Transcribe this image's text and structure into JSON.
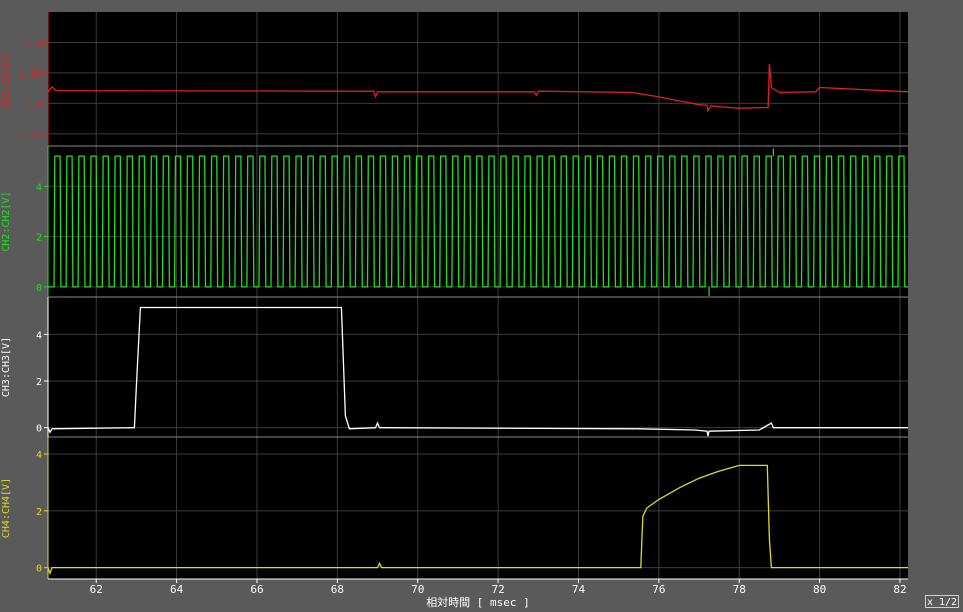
{
  "zoom_label": "x 1/2",
  "chart_data": {
    "type": "line",
    "x_label": "相対時間 [ msec ]",
    "x_range": [
      60.8,
      82.2
    ],
    "x_ticks": [
      62,
      64,
      66,
      68,
      70,
      72,
      74,
      76,
      78,
      80,
      82
    ],
    "grid": true,
    "background": "#000000",
    "channels": [
      {
        "name": "CH1:CH1[V]",
        "color": "#e02020",
        "y_range": [
          1.23,
          1.45
        ],
        "y_ticks": [
          1.4,
          1.35,
          1.3,
          1.25
        ],
        "tick_labels": [
          "1.4",
          "1.35",
          "1.3",
          "1.25"
        ],
        "x": [
          60.8,
          60.9,
          61.0,
          68.9,
          68.95,
          69.0,
          72.9,
          72.95,
          73.0,
          75.3,
          75.9,
          76.5,
          77.0,
          77.2,
          77.22,
          77.3,
          77.6,
          78.0,
          78.5,
          78.72,
          78.75,
          78.8,
          79.0,
          79.9,
          80.0,
          82.2
        ],
        "values": [
          1.318,
          1.327,
          1.321,
          1.32,
          1.311,
          1.319,
          1.319,
          1.313,
          1.32,
          1.318,
          1.312,
          1.304,
          1.298,
          1.297,
          1.288,
          1.296,
          1.294,
          1.292,
          1.293,
          1.293,
          1.365,
          1.326,
          1.318,
          1.319,
          1.326,
          1.319
        ]
      },
      {
        "name": "CH2:CH2[V]",
        "color": "#22dd22",
        "y_range": [
          -0.4,
          5.6
        ],
        "y_ticks": [
          0,
          2,
          4
        ],
        "tick_labels": [
          "0",
          "2",
          "4"
        ],
        "wave": "square",
        "low": 0.0,
        "high": 5.2,
        "period_ms": 0.3,
        "start_ms": 60.95,
        "notes": [
          {
            "x": 77.25,
            "values": [
              -0.5
            ]
          },
          {
            "x": 78.85,
            "values": [
              5.5
            ]
          }
        ]
      },
      {
        "name": "CH3:CH3[V]",
        "color": "#ffffff",
        "y_range": [
          -0.4,
          5.6
        ],
        "y_ticks": [
          0,
          2,
          4
        ],
        "tick_labels": [
          "0",
          "2",
          "4"
        ],
        "x": [
          60.8,
          60.85,
          60.9,
          62.95,
          63.0,
          63.1,
          68.1,
          68.2,
          68.3,
          68.95,
          69.0,
          69.05,
          75.5,
          76.9,
          77.2,
          77.22,
          77.25,
          78.5,
          78.8,
          78.85,
          79.0,
          82.2
        ],
        "values": [
          0.0,
          -0.2,
          -0.05,
          0.0,
          1.8,
          5.15,
          5.15,
          0.5,
          -0.05,
          0.0,
          0.2,
          0.0,
          -0.05,
          -0.1,
          -0.15,
          -0.5,
          -0.15,
          -0.1,
          0.2,
          0.0,
          0.0,
          0.0
        ]
      },
      {
        "name": "CH4:CH4[V]",
        "color": "#dddd22",
        "y_range": [
          -0.4,
          4.6
        ],
        "y_ticks": [
          0,
          2,
          4
        ],
        "tick_labels": [
          "0",
          "2",
          "4"
        ],
        "x": [
          60.8,
          60.85,
          60.9,
          69.0,
          69.05,
          69.1,
          75.55,
          75.6,
          75.7,
          76.0,
          76.5,
          77.0,
          77.5,
          78.0,
          78.7,
          78.75,
          78.8,
          82.2
        ],
        "values": [
          0.0,
          -0.2,
          0.0,
          0.0,
          0.15,
          0.0,
          0.0,
          1.8,
          2.1,
          2.4,
          2.8,
          3.15,
          3.4,
          3.6,
          3.6,
          1.0,
          0.0,
          0.0
        ]
      }
    ]
  }
}
